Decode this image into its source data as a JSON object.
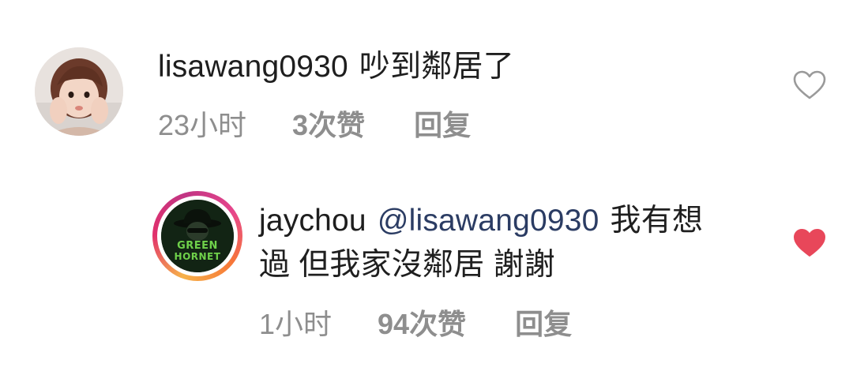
{
  "comments": [
    {
      "username": "lisawang0930",
      "text": "吵到鄰居了",
      "time": "23小时",
      "likes": "3次赞",
      "reply_label": "回复",
      "liked": false,
      "avatar_icon": "profile-photo-girl"
    },
    {
      "username": "jaychou",
      "mention": "@lisawang0930",
      "text_line1_tail": "我有想",
      "text_line2": "過 但我家沒鄰居 謝謝",
      "time": "1小时",
      "likes": "94次赞",
      "reply_label": "回复",
      "liked": true,
      "avatar_icon": "green-hornet-avatar",
      "avatar_text": "GREEN HORNET"
    }
  ],
  "colors": {
    "like_active": "#e8475a",
    "like_inactive": "#9a9a9a",
    "meta_text": "#8e8e8e",
    "mention": "#2b3c63"
  }
}
